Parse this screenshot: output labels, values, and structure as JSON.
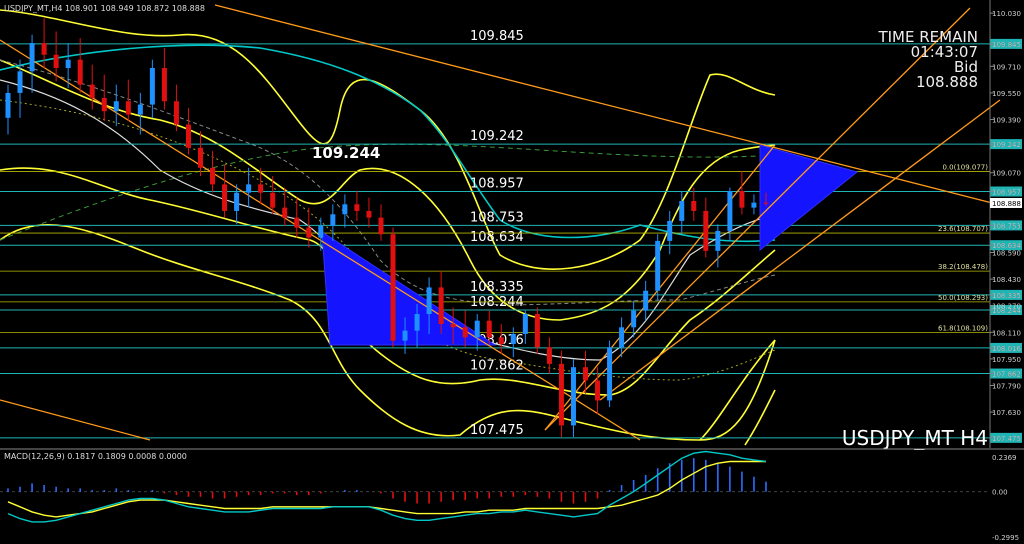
{
  "header": {
    "symbol_line": "USDJPY_MT,H4 108.901 108.949 108.872 108.888"
  },
  "watermark": "USDJPY_MT H4",
  "info": {
    "line1": "TIME REMAIN",
    "line2": "01:43:07",
    "line3": "Bid",
    "line4": "108.888"
  },
  "macd_label": "MACD(12,26,9) 0.1817 0.1809 0.0008 0.0000",
  "marked_high": "109.244",
  "colors": {
    "background": "#000000",
    "bull_candle": "#1e90ff",
    "bear_candle": "#e01010",
    "bollinger": "#ffff33",
    "ma_cyan": "#00c8c8",
    "trendline": "#ff9a1a",
    "level_line": "#1fb5b5",
    "fib_line": "#b8b800",
    "triangle_fill": "#1414ff",
    "macd_signal": "#ffff33",
    "macd_line": "#00c8c8"
  },
  "chart_data": [
    {
      "type": "candlestick",
      "title": "USDJPY_MT H4",
      "ylim": [
        107.42,
        110.085
      ],
      "y_ticks": [
        "110.030",
        "109.845",
        "109.710",
        "109.550",
        "109.390",
        "109.242",
        "109.070",
        "108.957",
        "108.888",
        "108.753",
        "108.590",
        "108.634",
        "108.430",
        "108.335",
        "108.270",
        "108.244",
        "108.110",
        "108.016",
        "107.950",
        "107.862",
        "107.790",
        "107.630",
        "107.475"
      ],
      "current_price": "108.888",
      "horizontal_levels": [
        {
          "label": "109.845",
          "value": 109.845
        },
        {
          "label": "109.242",
          "value": 109.242
        },
        {
          "label": "108.957",
          "value": 108.957
        },
        {
          "label": "108.753",
          "value": 108.753
        },
        {
          "label": "108.634",
          "value": 108.634
        },
        {
          "label": "108.335",
          "value": 108.335
        },
        {
          "label": "108.244",
          "value": 108.244
        },
        {
          "label": "108.016",
          "value": 108.016
        },
        {
          "label": "107.862",
          "value": 107.862
        },
        {
          "label": "107.475",
          "value": 107.475
        }
      ],
      "fibonacci": [
        {
          "label": "0.0(109.077)",
          "value": 109.077
        },
        {
          "label": "23.6(108.707)",
          "value": 108.707
        },
        {
          "label": "38.2(108.478)",
          "value": 108.478
        },
        {
          "label": "50.0(108.293)",
          "value": 108.293
        },
        {
          "label": "61.8(108.109)",
          "value": 108.109
        }
      ],
      "candles": [
        {
          "o": 109.4,
          "h": 109.6,
          "l": 109.3,
          "c": 109.55
        },
        {
          "o": 109.55,
          "h": 109.75,
          "l": 109.4,
          "c": 109.68
        },
        {
          "o": 109.68,
          "h": 109.9,
          "l": 109.55,
          "c": 109.85
        },
        {
          "o": 109.85,
          "h": 110.0,
          "l": 109.7,
          "c": 109.78
        },
        {
          "o": 109.78,
          "h": 109.92,
          "l": 109.62,
          "c": 109.7
        },
        {
          "o": 109.7,
          "h": 109.85,
          "l": 109.58,
          "c": 109.75
        },
        {
          "o": 109.75,
          "h": 109.88,
          "l": 109.55,
          "c": 109.6
        },
        {
          "o": 109.6,
          "h": 109.72,
          "l": 109.45,
          "c": 109.52
        },
        {
          "o": 109.52,
          "h": 109.66,
          "l": 109.38,
          "c": 109.44
        },
        {
          "o": 109.44,
          "h": 109.6,
          "l": 109.35,
          "c": 109.5
        },
        {
          "o": 109.5,
          "h": 109.63,
          "l": 109.38,
          "c": 109.42
        },
        {
          "o": 109.42,
          "h": 109.55,
          "l": 109.3,
          "c": 109.48
        },
        {
          "o": 109.48,
          "h": 109.75,
          "l": 109.4,
          "c": 109.7
        },
        {
          "o": 109.7,
          "h": 109.82,
          "l": 109.45,
          "c": 109.5
        },
        {
          "o": 109.5,
          "h": 109.6,
          "l": 109.32,
          "c": 109.36
        },
        {
          "o": 109.36,
          "h": 109.46,
          "l": 109.18,
          "c": 109.22
        },
        {
          "o": 109.22,
          "h": 109.32,
          "l": 109.05,
          "c": 109.1
        },
        {
          "o": 109.1,
          "h": 109.2,
          "l": 108.95,
          "c": 109.0
        },
        {
          "o": 109.0,
          "h": 109.12,
          "l": 108.8,
          "c": 108.84
        },
        {
          "o": 108.84,
          "h": 109.0,
          "l": 108.76,
          "c": 108.95
        },
        {
          "o": 108.95,
          "h": 109.1,
          "l": 108.86,
          "c": 109.0
        },
        {
          "o": 109.0,
          "h": 109.1,
          "l": 108.88,
          "c": 108.95
        },
        {
          "o": 108.95,
          "h": 109.05,
          "l": 108.82,
          "c": 108.86
        },
        {
          "o": 108.86,
          "h": 108.98,
          "l": 108.75,
          "c": 108.8
        },
        {
          "o": 108.8,
          "h": 108.92,
          "l": 108.68,
          "c": 108.74
        },
        {
          "o": 108.74,
          "h": 108.86,
          "l": 108.62,
          "c": 108.68
        },
        {
          "o": 108.68,
          "h": 108.8,
          "l": 108.6,
          "c": 108.75
        },
        {
          "o": 108.75,
          "h": 108.88,
          "l": 108.66,
          "c": 108.82
        },
        {
          "o": 108.82,
          "h": 108.94,
          "l": 108.74,
          "c": 108.88
        },
        {
          "o": 108.88,
          "h": 108.96,
          "l": 108.78,
          "c": 108.84
        },
        {
          "o": 108.84,
          "h": 108.92,
          "l": 108.74,
          "c": 108.8
        },
        {
          "o": 108.8,
          "h": 108.88,
          "l": 108.66,
          "c": 108.7
        },
        {
          "o": 108.7,
          "h": 108.74,
          "l": 108.02,
          "c": 108.06
        },
        {
          "o": 108.06,
          "h": 108.2,
          "l": 107.98,
          "c": 108.12
        },
        {
          "o": 108.12,
          "h": 108.28,
          "l": 108.02,
          "c": 108.22
        },
        {
          "o": 108.22,
          "h": 108.44,
          "l": 108.1,
          "c": 108.38
        },
        {
          "o": 108.38,
          "h": 108.48,
          "l": 108.1,
          "c": 108.16
        },
        {
          "o": 108.16,
          "h": 108.26,
          "l": 108.04,
          "c": 108.14
        },
        {
          "o": 108.14,
          "h": 108.24,
          "l": 108.02,
          "c": 108.08
        },
        {
          "o": 108.08,
          "h": 108.22,
          "l": 108.0,
          "c": 108.18
        },
        {
          "o": 108.18,
          "h": 108.24,
          "l": 108.04,
          "c": 108.08
        },
        {
          "o": 108.08,
          "h": 108.16,
          "l": 107.98,
          "c": 108.04
        },
        {
          "o": 108.04,
          "h": 108.14,
          "l": 107.96,
          "c": 108.1
        },
        {
          "o": 108.1,
          "h": 108.24,
          "l": 108.04,
          "c": 108.22
        },
        {
          "o": 108.22,
          "h": 108.26,
          "l": 107.98,
          "c": 108.02
        },
        {
          "o": 108.02,
          "h": 108.08,
          "l": 107.86,
          "c": 107.92
        },
        {
          "o": 107.92,
          "h": 108.0,
          "l": 107.48,
          "c": 107.55
        },
        {
          "o": 107.55,
          "h": 107.95,
          "l": 107.48,
          "c": 107.9
        },
        {
          "o": 107.9,
          "h": 108.0,
          "l": 107.74,
          "c": 107.82
        },
        {
          "o": 107.82,
          "h": 107.9,
          "l": 107.62,
          "c": 107.7
        },
        {
          "o": 107.7,
          "h": 108.06,
          "l": 107.66,
          "c": 108.02
        },
        {
          "o": 108.02,
          "h": 108.2,
          "l": 107.96,
          "c": 108.14
        },
        {
          "o": 108.14,
          "h": 108.3,
          "l": 108.08,
          "c": 108.24
        },
        {
          "o": 108.24,
          "h": 108.42,
          "l": 108.18,
          "c": 108.36
        },
        {
          "o": 108.36,
          "h": 108.7,
          "l": 108.3,
          "c": 108.66
        },
        {
          "o": 108.66,
          "h": 108.84,
          "l": 108.58,
          "c": 108.78
        },
        {
          "o": 108.78,
          "h": 108.96,
          "l": 108.7,
          "c": 108.9
        },
        {
          "o": 108.9,
          "h": 108.98,
          "l": 108.78,
          "c": 108.84
        },
        {
          "o": 108.84,
          "h": 108.92,
          "l": 108.56,
          "c": 108.6
        },
        {
          "o": 108.6,
          "h": 108.76,
          "l": 108.5,
          "c": 108.72
        },
        {
          "o": 108.72,
          "h": 108.98,
          "l": 108.66,
          "c": 108.96
        },
        {
          "o": 108.96,
          "h": 109.08,
          "l": 108.82,
          "c": 108.86
        },
        {
          "o": 108.86,
          "h": 108.94,
          "l": 108.82,
          "c": 108.89
        },
        {
          "o": 108.89,
          "h": 108.95,
          "l": 108.87,
          "c": 108.888
        }
      ]
    },
    {
      "type": "line",
      "title": "MACD(12,26,9)",
      "ylim": [
        -0.2995,
        0.2369
      ],
      "y_ticks": [
        "0.2369",
        "0.00",
        "-0.2995"
      ],
      "macd_hist": [
        0.02,
        0.03,
        0.05,
        0.04,
        0.03,
        0.02,
        0.02,
        0.01,
        0.01,
        0.02,
        0.01,
        0.0,
        0.01,
        -0.01,
        -0.02,
        -0.03,
        -0.03,
        -0.04,
        -0.04,
        -0.03,
        -0.02,
        -0.02,
        -0.01,
        -0.01,
        -0.02,
        -0.02,
        -0.01,
        0.0,
        0.01,
        0.01,
        0.0,
        -0.01,
        -0.04,
        -0.06,
        -0.07,
        -0.07,
        -0.06,
        -0.05,
        -0.05,
        -0.04,
        -0.04,
        -0.03,
        -0.03,
        -0.02,
        -0.03,
        -0.04,
        -0.06,
        -0.07,
        -0.06,
        -0.04,
        0.01,
        0.04,
        0.07,
        0.1,
        0.14,
        0.17,
        0.19,
        0.2,
        0.19,
        0.17,
        0.15,
        0.12,
        0.09,
        0.06
      ],
      "signal_line": [
        -0.06,
        -0.09,
        -0.12,
        -0.14,
        -0.15,
        -0.14,
        -0.13,
        -0.12,
        -0.1,
        -0.08,
        -0.06,
        -0.05,
        -0.05,
        -0.05,
        -0.06,
        -0.07,
        -0.08,
        -0.09,
        -0.1,
        -0.1,
        -0.1,
        -0.1,
        -0.09,
        -0.09,
        -0.09,
        -0.09,
        -0.09,
        -0.09,
        -0.09,
        -0.09,
        -0.09,
        -0.1,
        -0.11,
        -0.12,
        -0.13,
        -0.13,
        -0.13,
        -0.13,
        -0.12,
        -0.12,
        -0.11,
        -0.11,
        -0.11,
        -0.1,
        -0.1,
        -0.1,
        -0.1,
        -0.1,
        -0.1,
        -0.1,
        -0.09,
        -0.08,
        -0.06,
        -0.04,
        -0.02,
        0.02,
        0.07,
        0.11,
        0.15,
        0.17,
        0.18,
        0.18,
        0.18,
        0.18
      ],
      "macd_line": [
        -0.13,
        -0.16,
        -0.18,
        -0.18,
        -0.17,
        -0.15,
        -0.13,
        -0.11,
        -0.09,
        -0.07,
        -0.05,
        -0.04,
        -0.04,
        -0.05,
        -0.07,
        -0.09,
        -0.1,
        -0.11,
        -0.12,
        -0.12,
        -0.12,
        -0.11,
        -0.1,
        -0.1,
        -0.1,
        -0.1,
        -0.1,
        -0.09,
        -0.09,
        -0.09,
        -0.09,
        -0.11,
        -0.14,
        -0.16,
        -0.17,
        -0.17,
        -0.16,
        -0.15,
        -0.14,
        -0.13,
        -0.13,
        -0.12,
        -0.12,
        -0.11,
        -0.12,
        -0.13,
        -0.14,
        -0.15,
        -0.14,
        -0.13,
        -0.08,
        -0.04,
        0.0,
        0.05,
        0.1,
        0.15,
        0.2,
        0.23,
        0.24,
        0.23,
        0.22,
        0.2,
        0.19,
        0.18
      ]
    }
  ]
}
